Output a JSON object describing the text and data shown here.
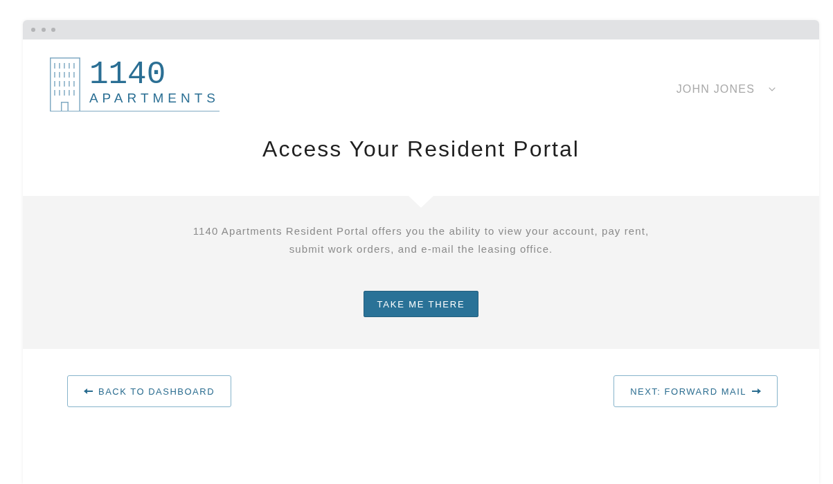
{
  "logo": {
    "number": "1140",
    "name": "APARTMENTS"
  },
  "user_menu": {
    "name": "JOHN JONES",
    "expanded": false
  },
  "heading": "Access Your Resident Portal",
  "intro": "1140 Apartments Resident Portal offers you the ability to view your account, pay rent, submit work orders, and e-mail the leasing office.",
  "primary_button": {
    "label": "TAKE ME THERE"
  },
  "nav": [
    {
      "kind": "back",
      "label": "BACK TO DASHBOARD"
    },
    {
      "kind": "next",
      "label": "NEXT: FORWARD MAIL"
    }
  ]
}
